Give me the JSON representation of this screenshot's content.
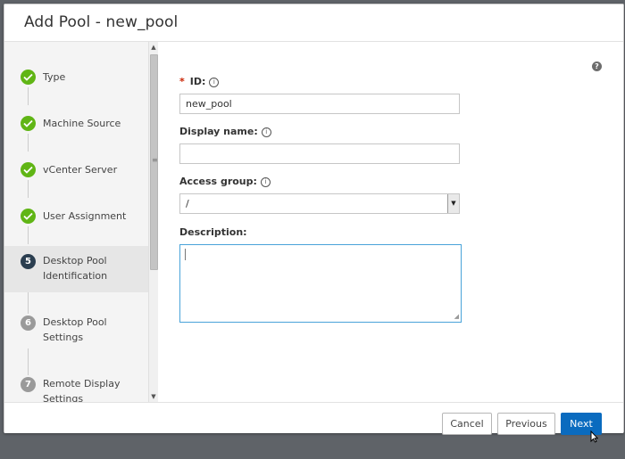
{
  "dialog": {
    "title": "Add Pool - new_pool",
    "help_icon": "help-icon"
  },
  "sidebar": {
    "steps": [
      {
        "label": "Type",
        "status": "complete"
      },
      {
        "label": "Machine Source",
        "status": "complete"
      },
      {
        "label": "vCenter Server",
        "status": "complete"
      },
      {
        "label": "User Assignment",
        "status": "complete"
      },
      {
        "number": "5",
        "label": "Desktop Pool\nIdentification",
        "status": "current"
      },
      {
        "number": "6",
        "label": "Desktop Pool\nSettings",
        "status": "pending"
      },
      {
        "number": "7",
        "label": "Remote Display\nSettings",
        "status": "pending"
      }
    ]
  },
  "form": {
    "id": {
      "required_marker": "*",
      "label": "ID:",
      "value": "new_pool"
    },
    "display_name": {
      "label": "Display name:",
      "value": ""
    },
    "access_group": {
      "label": "Access group:",
      "selected": "/"
    },
    "description": {
      "label": "Description:",
      "value": ""
    }
  },
  "footer": {
    "cancel_label": "Cancel",
    "previous_label": "Previous",
    "next_label": "Next"
  },
  "colors": {
    "complete": "#60b515",
    "current": "#2b3e50",
    "pending": "#9a9a9a",
    "primary_button": "#0a6bbf",
    "focus_border": "#49a3d9",
    "required": "#c92100"
  }
}
